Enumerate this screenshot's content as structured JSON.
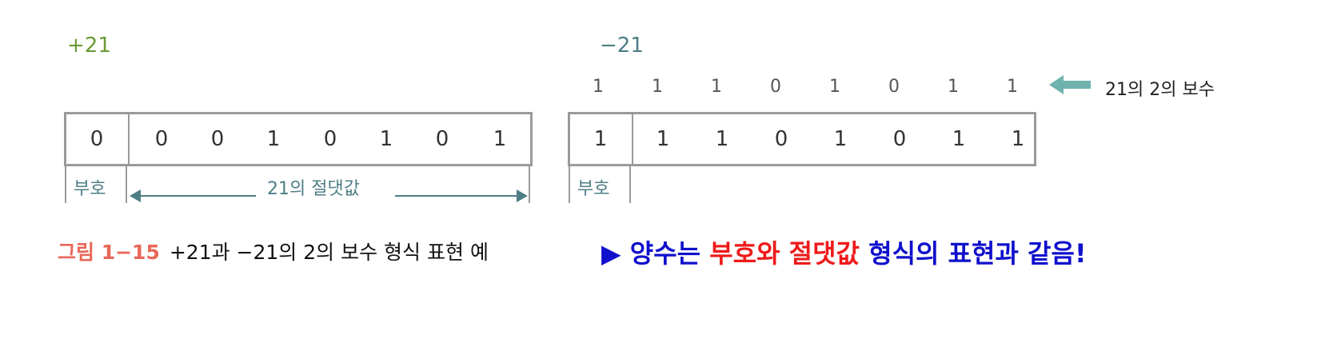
{
  "positive": {
    "label": "+21",
    "bits": [
      "0",
      "0",
      "0",
      "1",
      "0",
      "1",
      "0",
      "1"
    ],
    "sign_label": "부호",
    "magnitude_label": "21의 절댓값"
  },
  "negative": {
    "label": "−21",
    "complement_bits": [
      "1",
      "1",
      "1",
      "0",
      "1",
      "0",
      "1",
      "1"
    ],
    "bits": [
      "1",
      "1",
      "1",
      "0",
      "1",
      "0",
      "1",
      "1"
    ],
    "sign_label": "부호",
    "complement_label": "21의 2의 보수"
  },
  "caption": {
    "figure_number": "그림 1−15",
    "text": "+21과 −21의 2의 보수 형식 표현 예"
  },
  "note": {
    "marker": "▶",
    "part1": "양수는",
    "part2": "부호와 절댓값",
    "part3": "형식의 표현과 같음!"
  },
  "colors": {
    "positive_label": "#6a9a36",
    "teal": "#4d7e86",
    "caption_number": "#e8675a",
    "note_blue": "#1010cc",
    "note_red": "#ee1a1a"
  },
  "icons": {
    "complement_arrow": "left-arrow-icon"
  }
}
